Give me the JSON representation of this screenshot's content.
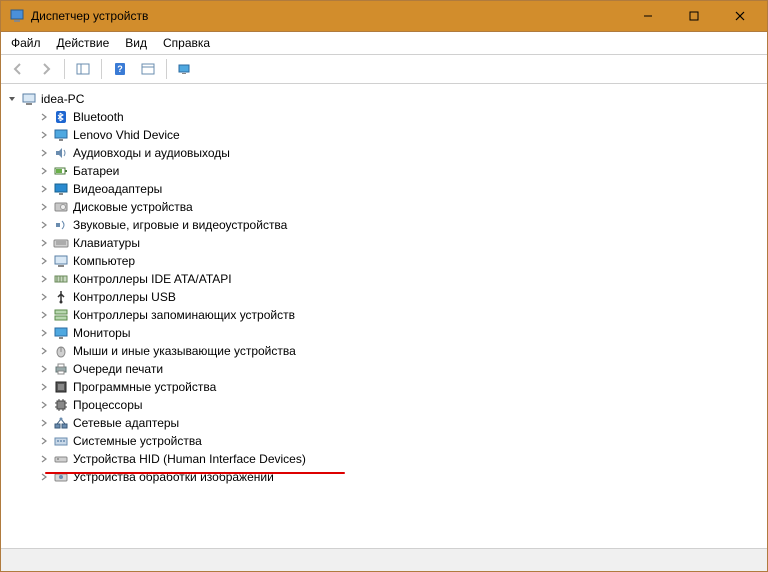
{
  "window": {
    "title": "Диспетчер устройств"
  },
  "menubar": {
    "items": [
      "Файл",
      "Действие",
      "Вид",
      "Справка"
    ]
  },
  "root": {
    "label": "idea-PC"
  },
  "categories": [
    {
      "label": "Bluetooth",
      "icon": "bluetooth"
    },
    {
      "label": "Lenovo Vhid Device",
      "icon": "monitor"
    },
    {
      "label": "Аудиовходы и аудиовыходы",
      "icon": "speaker"
    },
    {
      "label": "Батареи",
      "icon": "battery"
    },
    {
      "label": "Видеоадаптеры",
      "icon": "display"
    },
    {
      "label": "Дисковые устройства",
      "icon": "disk"
    },
    {
      "label": "Звуковые, игровые и видеоустройства",
      "icon": "sound"
    },
    {
      "label": "Клавиатуры",
      "icon": "keyboard"
    },
    {
      "label": "Компьютер",
      "icon": "computer"
    },
    {
      "label": "Контроллеры IDE ATA/ATAPI",
      "icon": "ide"
    },
    {
      "label": "Контроллеры USB",
      "icon": "usb"
    },
    {
      "label": "Контроллеры запоминающих устройств",
      "icon": "storage"
    },
    {
      "label": "Мониторы",
      "icon": "monitor"
    },
    {
      "label": "Мыши и иные указывающие устройства",
      "icon": "mouse"
    },
    {
      "label": "Очереди печати",
      "icon": "printer"
    },
    {
      "label": "Программные устройства",
      "icon": "software"
    },
    {
      "label": "Процессоры",
      "icon": "cpu"
    },
    {
      "label": "Сетевые адаптеры",
      "icon": "network"
    },
    {
      "label": "Системные устройства",
      "icon": "system"
    },
    {
      "label": "Устройства HID (Human Interface Devices)",
      "icon": "hid"
    },
    {
      "label": "Устройства обработки изображений",
      "icon": "imaging"
    }
  ]
}
